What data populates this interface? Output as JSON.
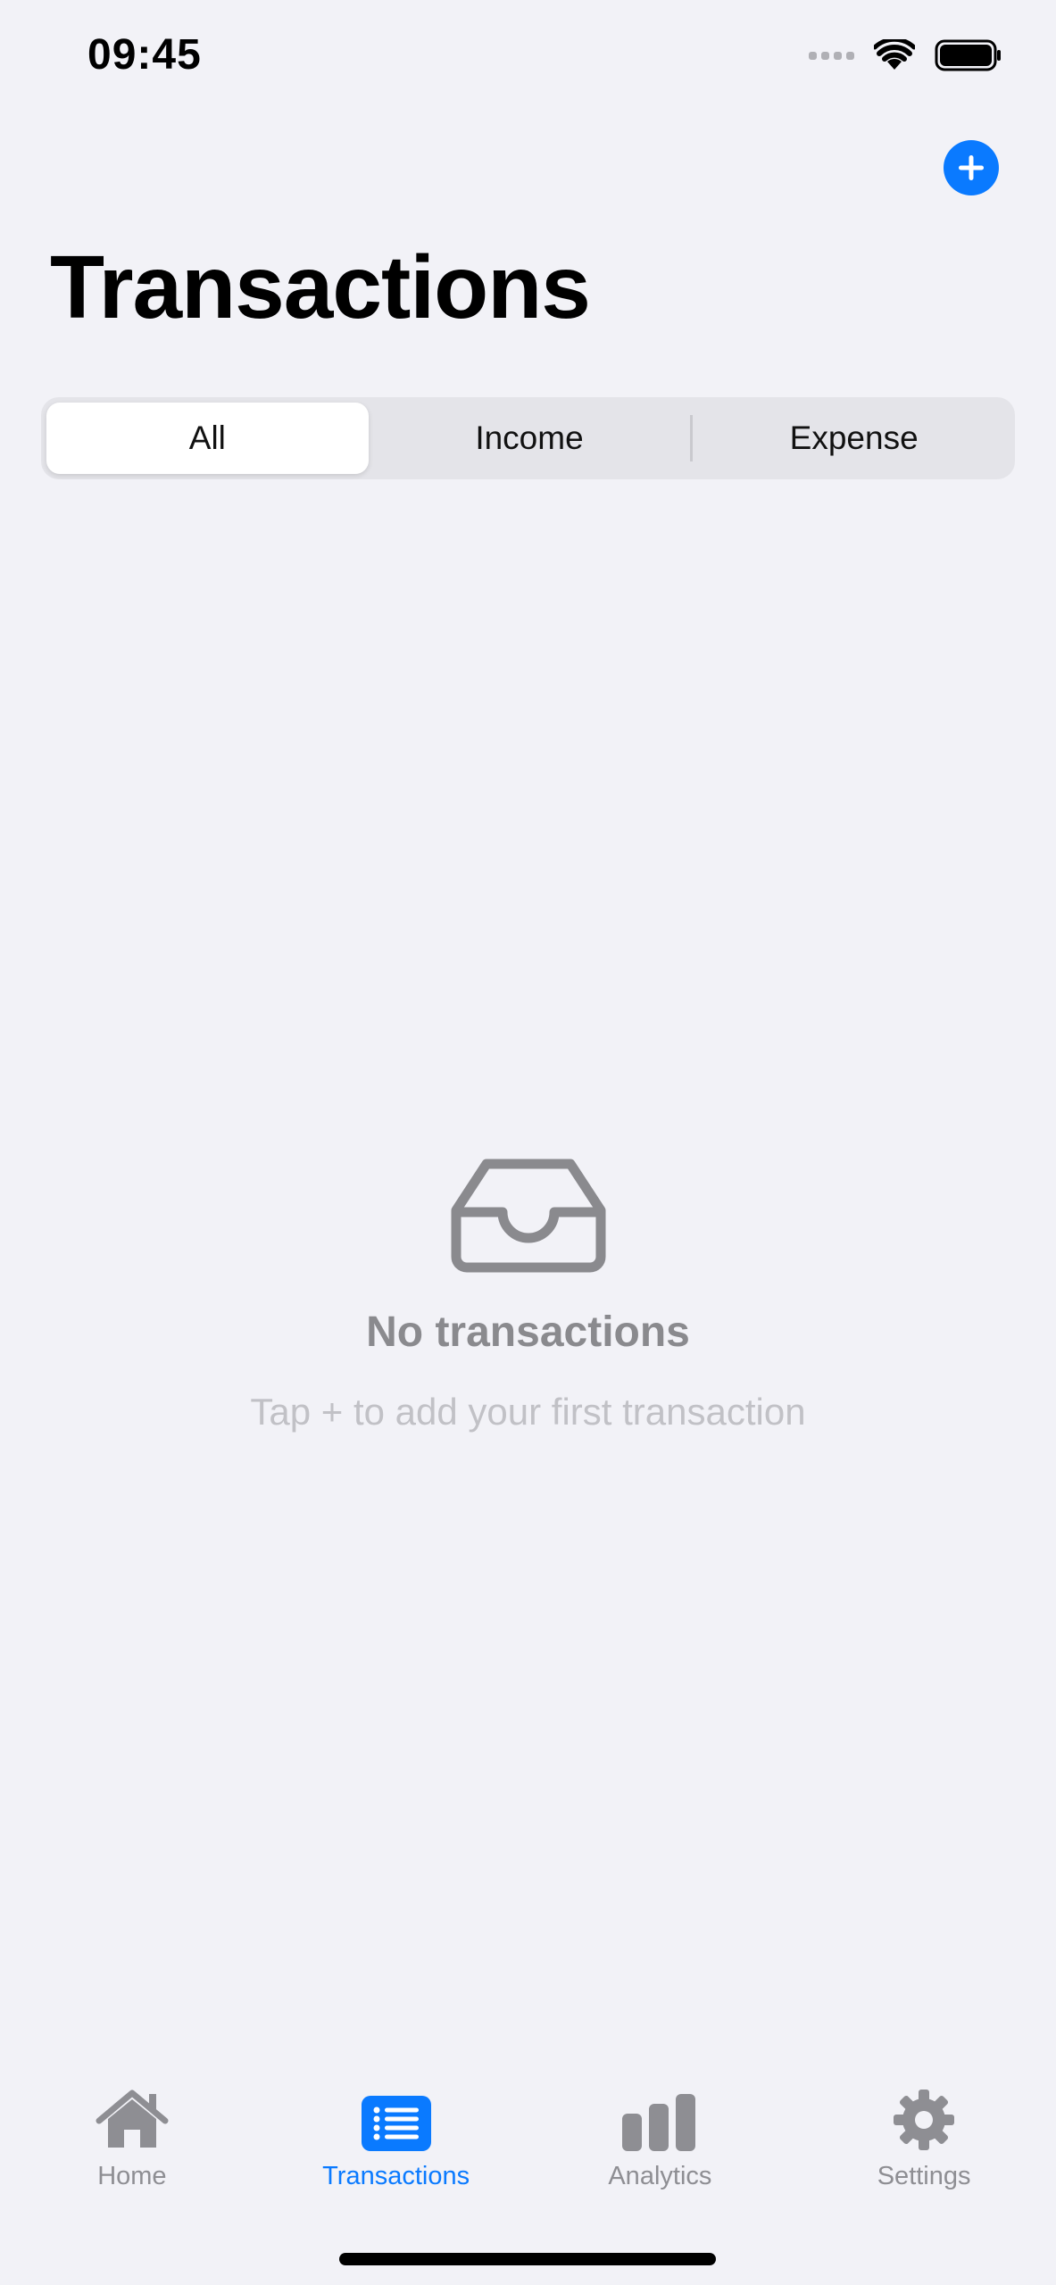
{
  "status_bar": {
    "time": "09:45"
  },
  "header": {
    "title": "Transactions",
    "add_icon": "plus-icon"
  },
  "filter": {
    "segments": [
      "All",
      "Income",
      "Expense"
    ],
    "selected": "All"
  },
  "empty_state": {
    "icon": "tray-icon",
    "title": "No transactions",
    "subtitle": "Tap + to add your first transaction"
  },
  "tabbar": {
    "tabs": [
      {
        "label": "Home",
        "icon": "house-icon"
      },
      {
        "label": "Transactions",
        "icon": "list-icon"
      },
      {
        "label": "Analytics",
        "icon": "bar-chart-icon"
      },
      {
        "label": "Settings",
        "icon": "gear-icon"
      }
    ],
    "active": "Transactions"
  },
  "colors": {
    "accent": "#0a7aff",
    "background": "#f2f2f7",
    "inactive": "#8e8e93"
  }
}
